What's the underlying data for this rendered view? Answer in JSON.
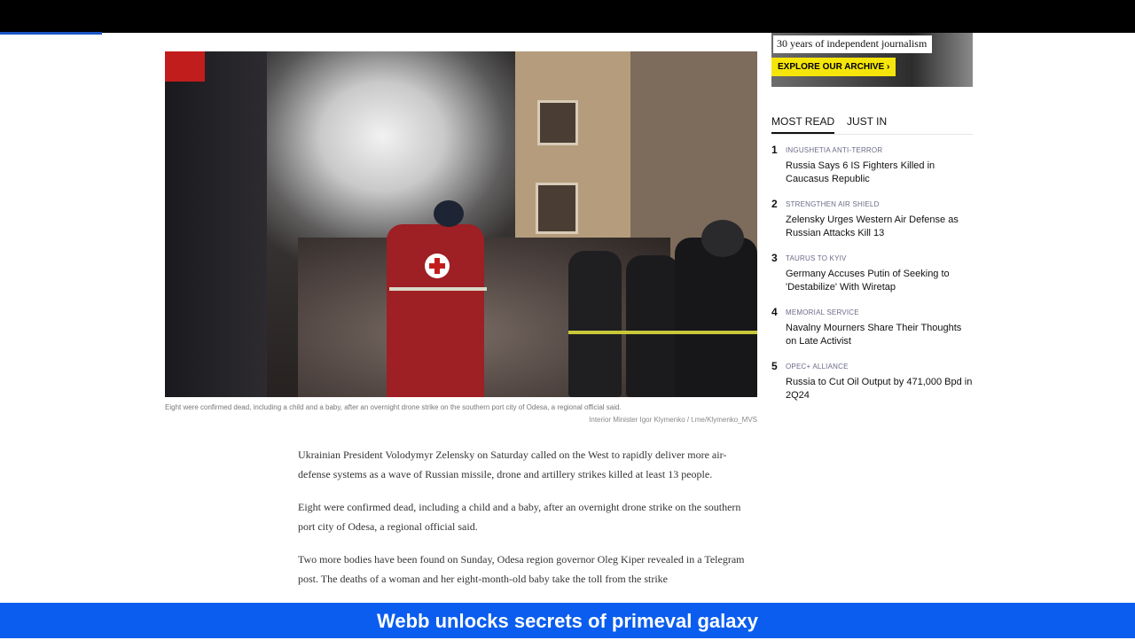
{
  "topbar": {},
  "reading_progress": 0.09,
  "hero_image": {
    "caption": "Eight were confirmed dead, including a child and a baby, after an overnight drone strike on the southern port city of Odesa, a regional official said.",
    "credit": "Interior Minister Igor Klymenko / t.me/Klymenko_MVS"
  },
  "article": {
    "paragraphs": [
      "Ukrainian President Volodymyr Zelensky on Saturday called on the West to rapidly deliver more air-defense systems as a wave of Russian missile, drone and artillery strikes killed at least 13 people.",
      "Eight were confirmed dead, including a child and a baby, after an overnight drone strike on the southern port city of Odesa, a regional official said.",
      "Two more bodies have been found on Sunday, Odesa region governor Oleg Kiper revealed in a Telegram post. The deaths of a woman and her eight-month-old baby take the toll from the strike"
    ]
  },
  "promo": {
    "text": "30 years of independent journalism",
    "button": "EXPLORE OUR ARCHIVE",
    "button_icon": "chevron-right-icon"
  },
  "sidebar": {
    "tabs": [
      "MOST READ",
      "JUST IN"
    ],
    "active_tab": 0,
    "items": [
      {
        "num": "1",
        "tag": "INGUSHETIA ANTI-TERROR",
        "title": "Russia Says 6 IS Fighters Killed in Caucasus Republic"
      },
      {
        "num": "2",
        "tag": "STRENGTHEN AIR SHIELD",
        "title": "Zelensky Urges Western Air Defense as Russian Attacks Kill 13"
      },
      {
        "num": "3",
        "tag": "TAURUS TO KYIV",
        "title": "Germany Accuses Putin of Seeking to 'Destabilize' With Wiretap"
      },
      {
        "num": "4",
        "tag": "MEMORIAL SERVICE",
        "title": "Navalny Mourners Share Their Thoughts on Late Activist"
      },
      {
        "num": "5",
        "tag": "OPEC+ ALLIANCE",
        "title": "Russia to Cut Oil Output by 471,000 Bpd in 2Q24"
      }
    ]
  },
  "ticker": {
    "text": "Webb unlocks secrets of primeval galaxy"
  },
  "colors": {
    "ticker_bg": "#0a5dee",
    "promo_button": "#f5e50a",
    "progress": "#1a56c4"
  }
}
